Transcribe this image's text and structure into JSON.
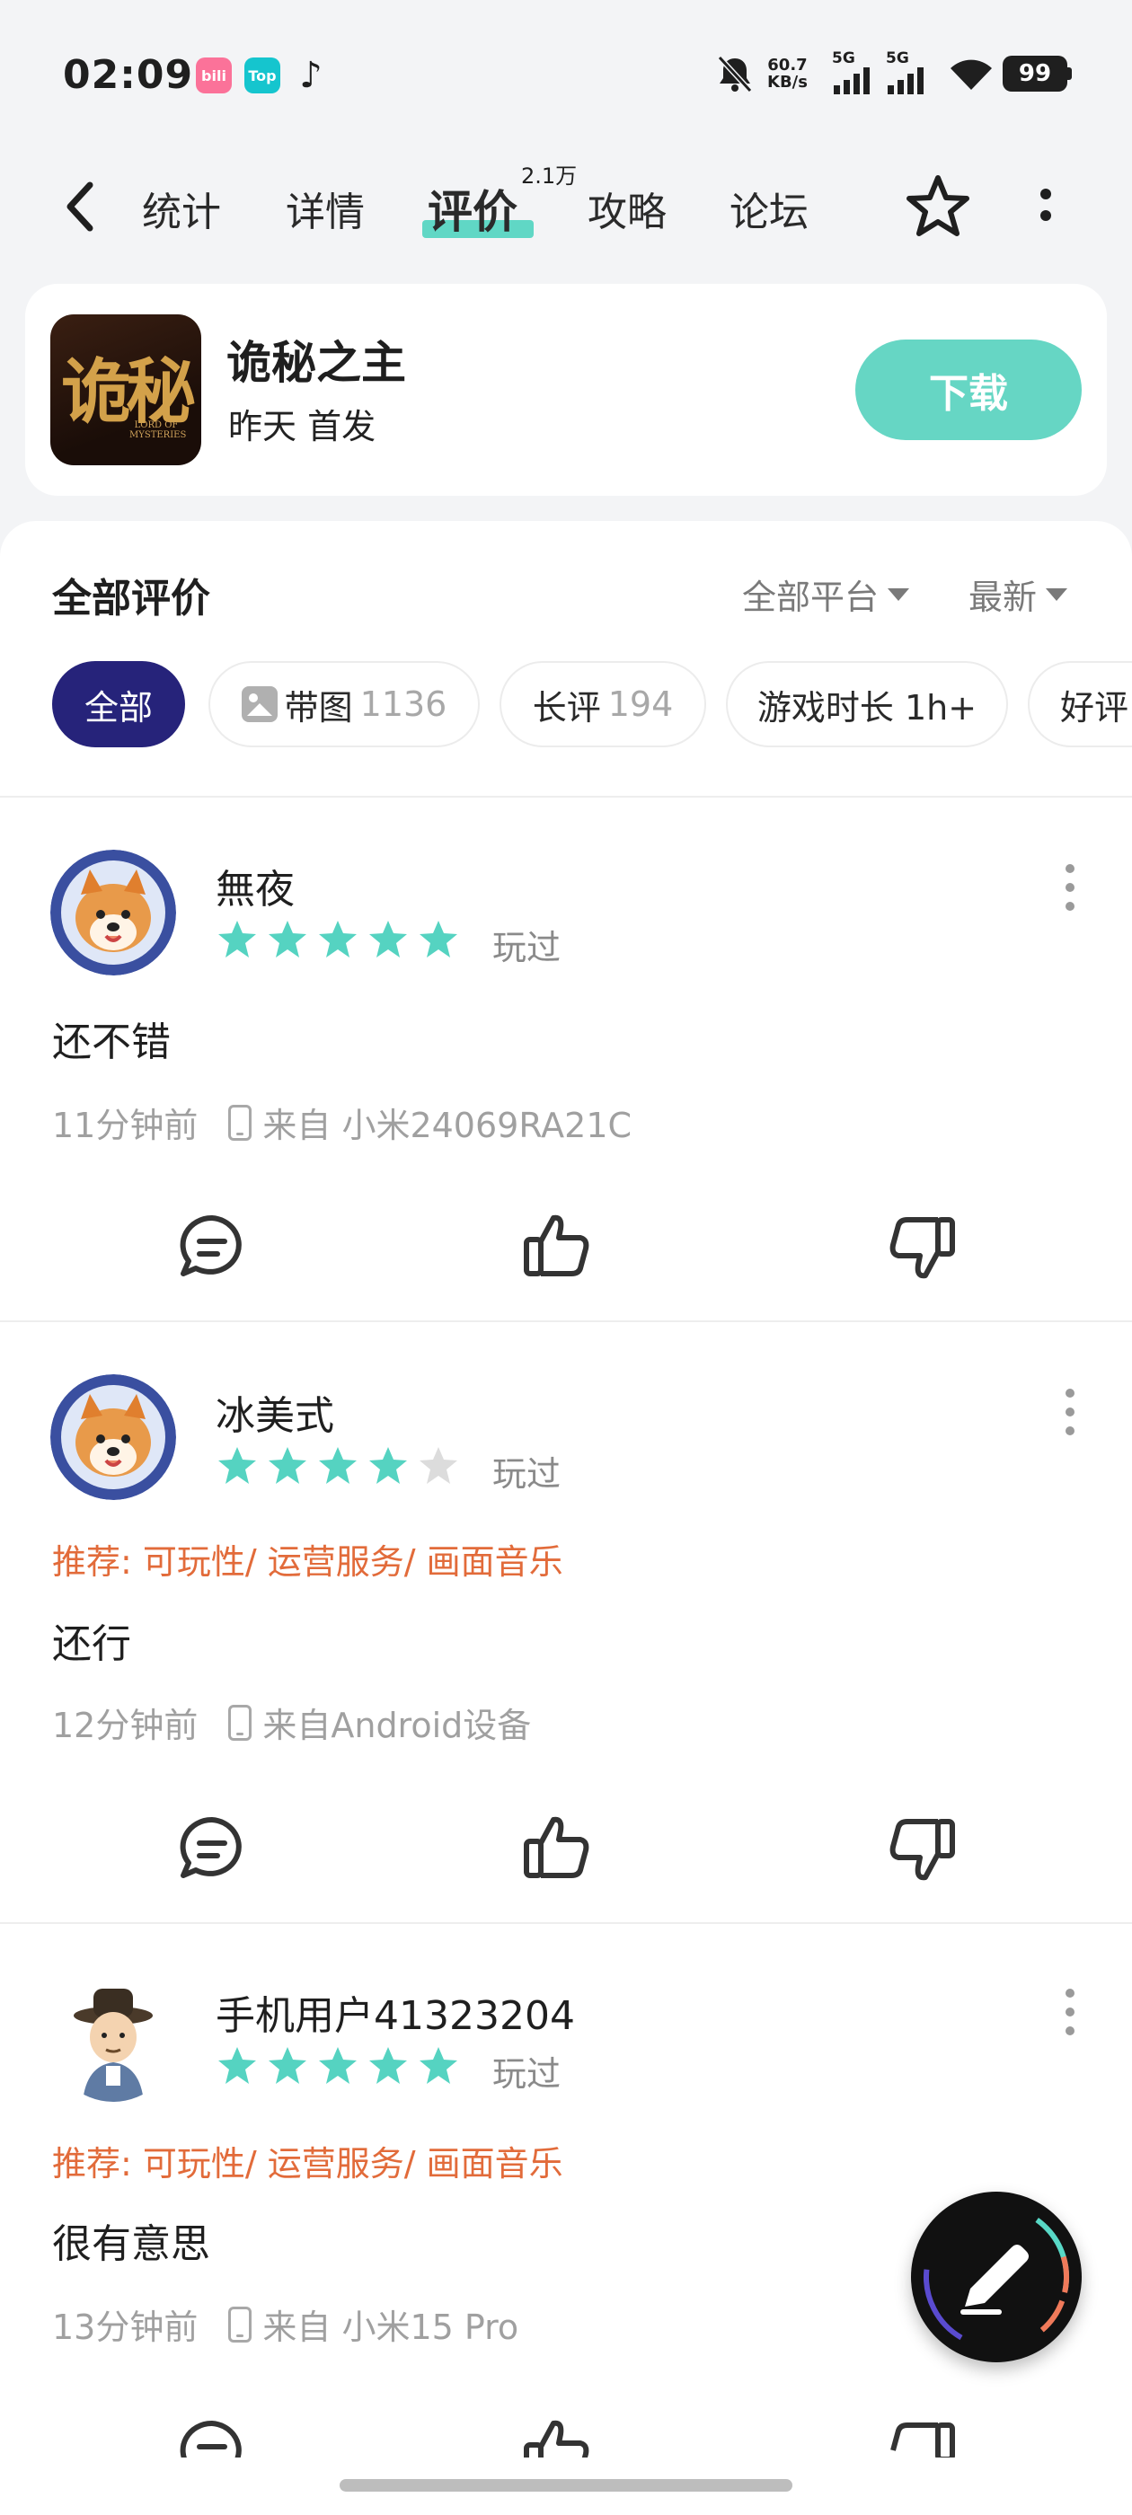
{
  "status_bar": {
    "time": "02:09",
    "apps": [
      {
        "icon": "bilibili-icon",
        "label": "bili",
        "color": "#fb7299"
      },
      {
        "icon": "taptap-icon",
        "label": "Top",
        "color": "#15c5ce"
      },
      {
        "icon": "tiktok-icon",
        "label": "♪",
        "color": "#1f1f1f"
      }
    ],
    "net_speed_value": "60.7",
    "net_speed_unit": "KB/s",
    "sim1": "5G",
    "sim2": "5G",
    "battery": "99"
  },
  "nav": {
    "tabs": [
      {
        "label": "统计",
        "active": false
      },
      {
        "label": "详情",
        "active": false
      },
      {
        "label": "评价",
        "active": true
      },
      {
        "label": "攻略",
        "active": false
      },
      {
        "label": "论坛",
        "active": false
      }
    ],
    "review_count_badge": "2.1万"
  },
  "game": {
    "title": "诡秘之主",
    "icon_text": "诡秘",
    "icon_subtext": "LORD OF MYSTERIES",
    "subtitle": "昨天 首发",
    "download_label": "下载"
  },
  "reviews_header": {
    "title": "全部评价",
    "platform_filter": "全部平台",
    "sort": "最新"
  },
  "chips": [
    {
      "label": "全部",
      "count": "",
      "active": true
    },
    {
      "label": "带图",
      "count": "1136",
      "active": false
    },
    {
      "label": "长评",
      "count": "194",
      "active": false
    },
    {
      "label": "游戏时长 1h+",
      "count": "",
      "active": false
    },
    {
      "label": "好评",
      "count": "",
      "active": false
    }
  ],
  "reviews": [
    {
      "user": "無夜",
      "rating": 5,
      "played": "玩过",
      "recommend": "",
      "content": "还不错",
      "time": "11分钟前",
      "device": "来自 小米24069RA21C",
      "avatar": "shiba-astronaut"
    },
    {
      "user": "冰美式",
      "rating": 4,
      "played": "玩过",
      "recommend": "推荐: 可玩性/ 运营服务/ 画面音乐",
      "content": "还行",
      "time": "12分钟前",
      "device": "来自Android设备",
      "avatar": "shiba-astronaut"
    },
    {
      "user": "手机用户41323204",
      "rating": 5,
      "played": "玩过",
      "recommend": "推荐: 可玩性/ 运营服务/ 画面音乐",
      "content": "很有意思",
      "time": "13分钟前",
      "device": "来自 小米15 Pro",
      "avatar": "official-cartoon"
    }
  ],
  "colors": {
    "accent": "#60d7c5",
    "star_on": "#55d3c1",
    "star_off": "#dcdcdc",
    "chip_active": "#26237a",
    "recommend": "#e26b3a"
  }
}
